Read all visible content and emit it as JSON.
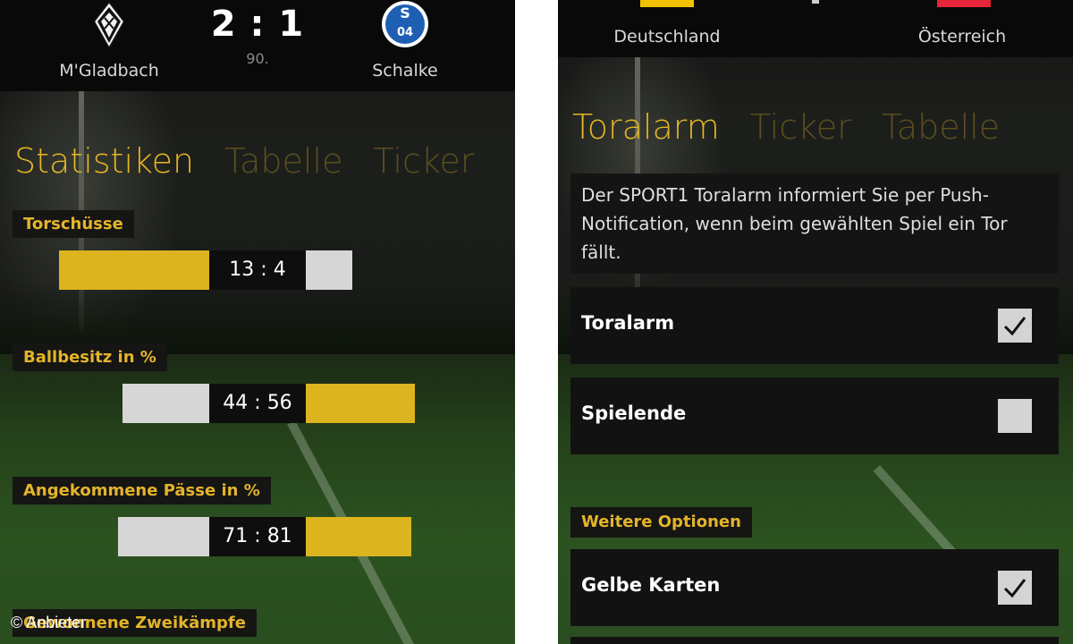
{
  "credit": "© Anbieter",
  "left_screen": {
    "header": {
      "home_team": "M'Gladbach",
      "away_team": "Schalke",
      "score": "2 : 1",
      "minute": "90.",
      "away_crest_text": "04"
    },
    "tabs": [
      "Statistiken",
      "Tabelle",
      "Ticker"
    ],
    "stats": [
      {
        "label": "Torschüsse",
        "value": "13 : 4",
        "home": 13,
        "away": 4,
        "home_color": "gold",
        "away_color": "grey"
      },
      {
        "label": "Ballbesitz in %",
        "value": "44 : 56",
        "home": 44,
        "away": 56,
        "home_color": "grey",
        "away_color": "gold"
      },
      {
        "label": "Angekommene Pässe in %",
        "value": "71 : 81",
        "home": 71,
        "away": 81,
        "home_color": "grey",
        "away_color": "gold"
      },
      {
        "label": "Gewonnene Zweikämpfe",
        "value": "",
        "home": null,
        "away": null
      }
    ]
  },
  "right_screen": {
    "header": {
      "home_country": "Deutschland",
      "away_country": "Österreich",
      "home_flag_color": "#f2c200",
      "away_flag_color": "#e8263b"
    },
    "tabs": [
      "Toralarm",
      "Ticker",
      "Tabelle"
    ],
    "info_text": "Der SPORT1 Toralarm informiert Sie per Push-Notification, wenn beim gewählten Spiel ein Tor fällt.",
    "options": [
      {
        "label": "Toralarm",
        "checked": true
      },
      {
        "label": "Spielende",
        "checked": false
      }
    ],
    "section_label": "Weitere Optionen",
    "more_options": [
      {
        "label": "Gelbe Karten",
        "checked": true
      }
    ]
  }
}
